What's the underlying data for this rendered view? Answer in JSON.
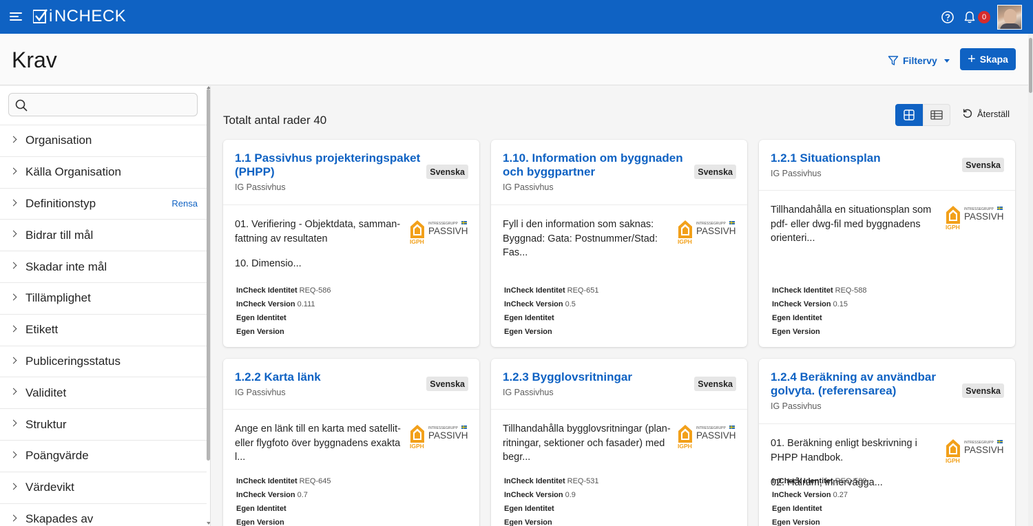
{
  "app": {
    "logo_text": "NCHECK",
    "notification_count": "0"
  },
  "page": {
    "title": "Krav",
    "filter_view_label": "Filtervy",
    "create_label": "Skapa"
  },
  "sidebar": {
    "search_placeholder": "",
    "filters": [
      {
        "label": "Organisation",
        "clear": ""
      },
      {
        "label": "Källa Organisation",
        "clear": ""
      },
      {
        "label": "Definitionstyp",
        "clear": "Rensa"
      },
      {
        "label": "Bidrar till mål",
        "clear": ""
      },
      {
        "label": "Skadar inte mål",
        "clear": ""
      },
      {
        "label": "Tillämplighet",
        "clear": ""
      },
      {
        "label": "Etikett",
        "clear": ""
      },
      {
        "label": "Publiceringsstatus",
        "clear": ""
      },
      {
        "label": "Validitet",
        "clear": ""
      },
      {
        "label": "Struktur",
        "clear": ""
      },
      {
        "label": "Poängvärde",
        "clear": ""
      },
      {
        "label": "Värdevikt",
        "clear": ""
      },
      {
        "label": "Skapades av",
        "clear": ""
      }
    ]
  },
  "main": {
    "total_rows_label": "Totalt antal rader 40",
    "reset_label": "Återställ",
    "meta_labels": {
      "incheck_identity": "InCheck Identitet",
      "incheck_version": "InCheck Version",
      "own_identity": "Egen Identitet",
      "own_version": "Egen Version"
    },
    "logo_text": {
      "top": "INTRESSEGRUPP",
      "main": "PASSIVHUS",
      "abbr": "IGPH"
    },
    "cards": [
      {
        "title": "1.1 Passivhus projekteringspaket (PHPP)",
        "org": "IG Passivhus",
        "lang": "Svenska",
        "desc": [
          "01. Verifiering - Objektdata, samman-fattning av resultaten",
          "10. Dimensio..."
        ],
        "incheck_id": "REQ-586",
        "incheck_version": "0.111"
      },
      {
        "title": "1.10. Information om byggnaden och byggpartner",
        "org": "IG Passivhus",
        "lang": "Svenska",
        "desc": [
          "Fyll i den information som saknas: Byggnad: Gata: Postnummer/Stad: Fas..."
        ],
        "incheck_id": "REQ-651",
        "incheck_version": "0.5"
      },
      {
        "title": "1.2.1 Situationsplan",
        "org": "IG Passivhus",
        "lang": "Svenska",
        "desc": [
          "Tillhandahålla en situationsplan som pdf- eller dwg-fil med byggnadens orienteri..."
        ],
        "incheck_id": "REQ-588",
        "incheck_version": "0.15"
      },
      {
        "title": "1.2.2 Karta länk",
        "org": "IG Passivhus",
        "lang": "Svenska",
        "desc": [
          "Ange en länk till en karta med satellit-eller flygfoto över byggnadens exakta l..."
        ],
        "incheck_id": "REQ-645",
        "incheck_version": "0.7"
      },
      {
        "title": "1.2.3 Bygglovsritningar",
        "org": "IG Passivhus",
        "lang": "Svenska",
        "desc": [
          "Tillhandahålla bygglovsritningar (plan-ritningar, sektioner och fasader) med begr..."
        ],
        "incheck_id": "REQ-531",
        "incheck_version": "0.9"
      },
      {
        "title": "1.2.4 Beräkning av användbar golvyta. (referensarea)",
        "org": "IG Passivhus",
        "lang": "Svenska",
        "desc": [
          "01. Beräkning enligt beskrivning i PHPP Handbok.",
          "02. Hålrum, innervägga..."
        ],
        "incheck_id": "REQ-589",
        "incheck_version": "0.27"
      }
    ]
  },
  "colors": {
    "brand": "#0f62c3",
    "badge_red": "#d62c2c",
    "logo_orange": "#f2a01a"
  }
}
